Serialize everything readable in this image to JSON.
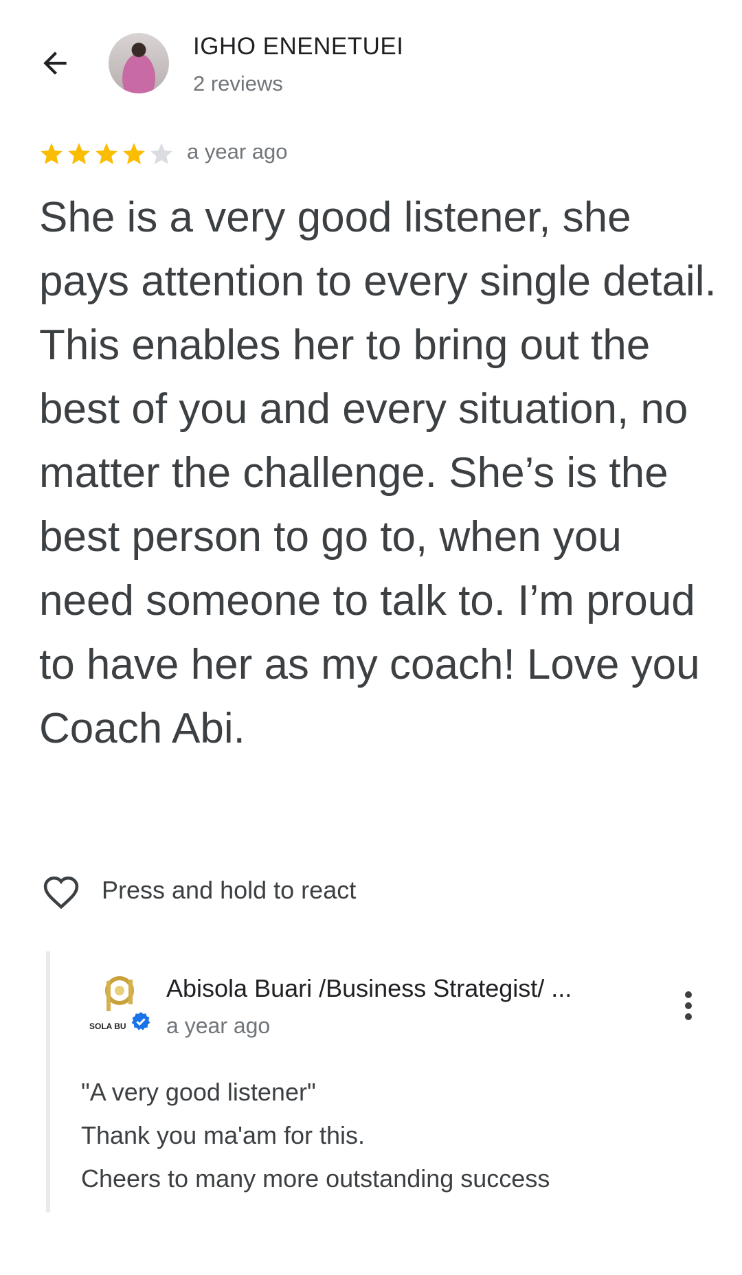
{
  "header": {
    "back_icon": "arrow-back-icon",
    "reviewer_name": "IGHO ENENETUEI",
    "reviewer_count": "2 reviews"
  },
  "review": {
    "rating": 4,
    "rating_max": 5,
    "star_color": "#fbbc04",
    "star_empty_color": "#dadce0",
    "time": "a year ago",
    "text": "She is a very good listener, she pays attention to every single detail. This enables her to bring out the best of you and every situation, no matter the challenge. She’s is the best person to go to, when you need someone to talk to. I’m proud to have her as my coach! Love you Coach Abi."
  },
  "reaction": {
    "icon": "heart-outline-icon",
    "label": "Press and hold to react"
  },
  "owner_reply": {
    "name": "Abisola Buari /Business Strategist/ ...",
    "logo_text": "SOLA BU",
    "verified_color": "#1a73e8",
    "time": "a year ago",
    "more_icon": "more-vert-icon",
    "lines": [
      "\"A very good listener\"",
      "Thank you ma'am for this.",
      "Cheers to many more outstanding success"
    ]
  }
}
